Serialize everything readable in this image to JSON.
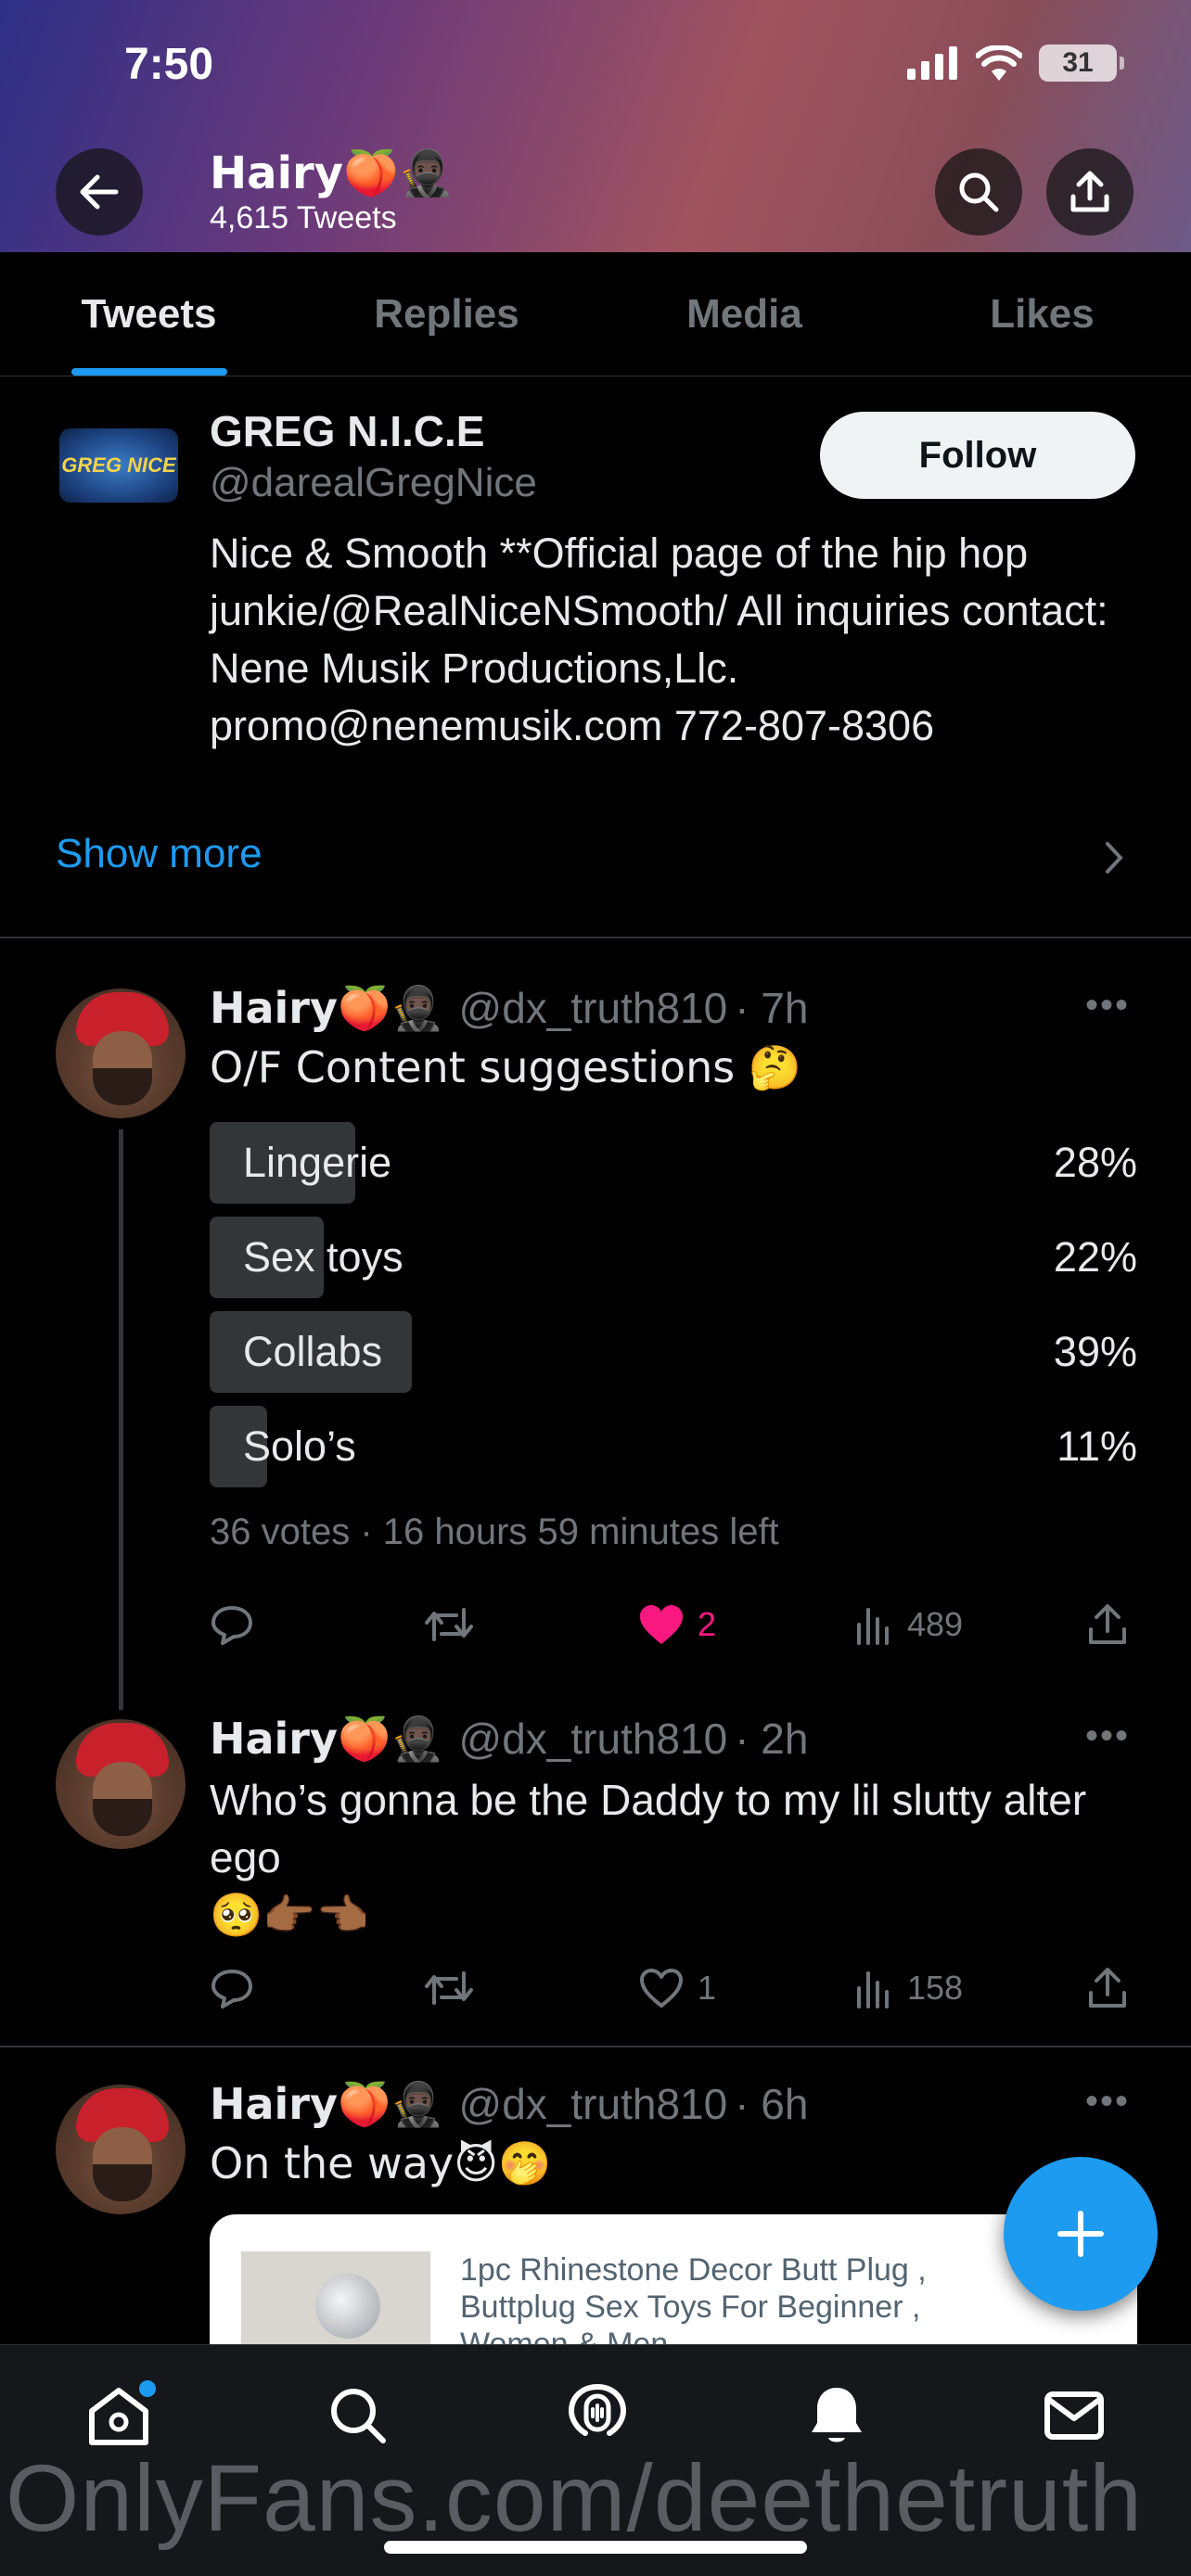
{
  "status_bar": {
    "time": "7:50",
    "battery": "31"
  },
  "profile": {
    "name": "Hairy🍑🥷🏿",
    "tweet_count": "4,615 Tweets"
  },
  "tabs": [
    {
      "label": "Tweets",
      "active": true
    },
    {
      "label": "Replies",
      "active": false
    },
    {
      "label": "Media",
      "active": false
    },
    {
      "label": "Likes",
      "active": false
    }
  ],
  "suggested_account": {
    "name": "GREG N.I.C.E",
    "handle": "@darealGregNice",
    "logo_text": "GREG NICE",
    "follow_label": "Follow",
    "bio": "Nice & Smooth **Official page of the hip hop junkie/@RealNiceNSmooth/ All inquiries contact: Nene Musik Productions,Llc. promo@nenemusik.com 772-807-8306",
    "show_more": "Show more"
  },
  "tweets": [
    {
      "name": "Hairy🍑🥷🏿",
      "handle": "@dx_truth810",
      "time": "· 7h",
      "text": "O/F Content suggestions 🤔",
      "poll": {
        "options": [
          {
            "label": "Lingerie",
            "percent": "28%",
            "fraction": 0.28
          },
          {
            "label": "Sex toys",
            "percent": "22%",
            "fraction": 0.22
          },
          {
            "label": "Collabs",
            "percent": "39%",
            "fraction": 0.39
          },
          {
            "label": "Solo’s",
            "percent": "11%",
            "fraction": 0.11
          }
        ],
        "meta": "36 votes · 16 hours 59 minutes left"
      },
      "likes": "2",
      "views": "489"
    },
    {
      "name": "Hairy🍑🥷🏿",
      "handle": "@dx_truth810",
      "time": "· 2h",
      "text": "Who’s gonna be the Daddy to my lil slutty alter ego",
      "text2": "🥺👉🏾👈🏾",
      "likes": "1",
      "views": "158"
    },
    {
      "name": "Hairy🍑🥷🏿",
      "handle": "@dx_truth810",
      "time": "· 6h",
      "text": "On the way😈🤭",
      "card_title": "1pc Rhinestone Decor Butt Plug , Buttplug Sex Toys For Beginner , Women & Men"
    }
  ],
  "watermark": "OnlyFans.com/deethetruth",
  "colors": {
    "accent": "#1d9bf0",
    "like": "#f91880",
    "background": "#000000"
  }
}
